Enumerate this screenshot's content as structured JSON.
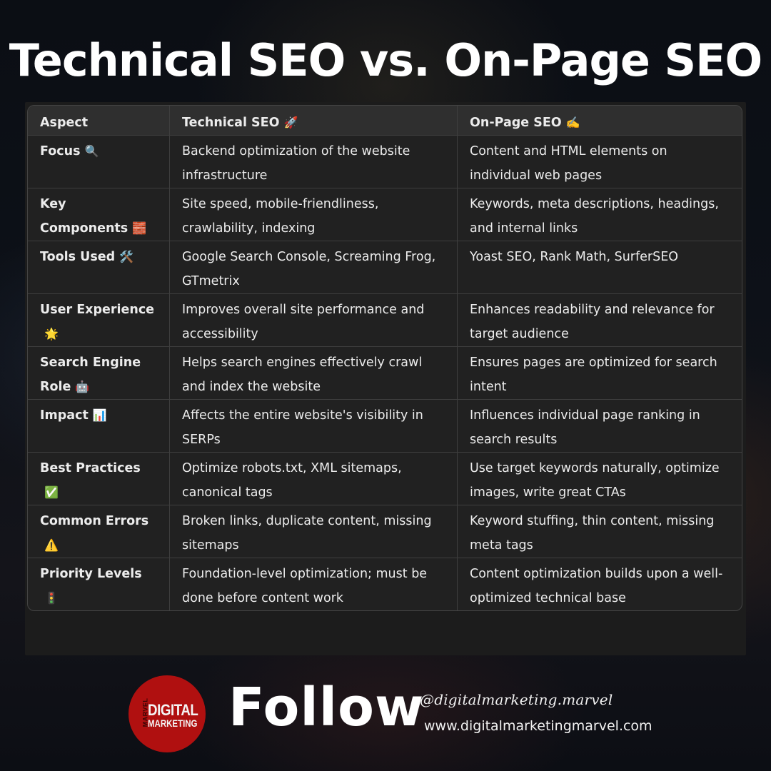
{
  "title": "Technical SEO vs. On-Page SEO",
  "table": {
    "headers": [
      {
        "label": "Aspect",
        "emoji": ""
      },
      {
        "label": "Technical SEO",
        "emoji": "🚀"
      },
      {
        "label": "On-Page SEO",
        "emoji": "✍️"
      }
    ],
    "rows": [
      {
        "aspect": "Focus",
        "emoji": "🔍",
        "technical": "Backend optimization of the website infrastructure",
        "onpage": "Content and HTML elements on individual web pages"
      },
      {
        "aspect": "Key Components",
        "emoji": "🧱",
        "technical": "Site speed, mobile-friendliness, crawlability, indexing",
        "onpage": "Keywords, meta descriptions, headings, and internal links"
      },
      {
        "aspect": "Tools Used",
        "emoji": "🛠️",
        "technical": "Google Search Console, Screaming Frog, GTmetrix",
        "onpage": "Yoast SEO, Rank Math, SurferSEO"
      },
      {
        "aspect": "User Experience",
        "emoji": "🌟",
        "technical": "Improves overall site performance and accessibility",
        "onpage": "Enhances readability and relevance for target audience"
      },
      {
        "aspect": "Search Engine Role",
        "emoji": "🤖",
        "technical": "Helps search engines effectively crawl and index the website",
        "onpage": "Ensures pages are optimized for search intent"
      },
      {
        "aspect": "Impact",
        "emoji": "📊",
        "technical": "Affects the entire website's visibility in SERPs",
        "onpage": "Influences individual page ranking in search results"
      },
      {
        "aspect": "Best Practices",
        "emoji": "✅",
        "technical": "Optimize robots.txt, XML sitemaps, canonical tags",
        "onpage": "Use target keywords naturally, optimize images, write great CTAs"
      },
      {
        "aspect": "Common Errors",
        "emoji": "⚠️",
        "technical": "Broken links, duplicate content, missing sitemaps",
        "onpage": "Keyword stuffing, thin content, missing meta tags"
      },
      {
        "aspect": "Priority Levels",
        "emoji": "🚦",
        "technical": "Foundation-level optimization; must be done before content work",
        "onpage": "Content optimization builds upon a well-optimized technical base"
      }
    ]
  },
  "footer": {
    "logo": {
      "side_text": "MARVEL",
      "line1": "DIGITAL",
      "line2": "MARKETING",
      "color": "#b01010"
    },
    "follow_label": "Follow",
    "handle": "@digitalmarketing.marvel",
    "website": "www.digitalmarketingmarvel.com"
  }
}
